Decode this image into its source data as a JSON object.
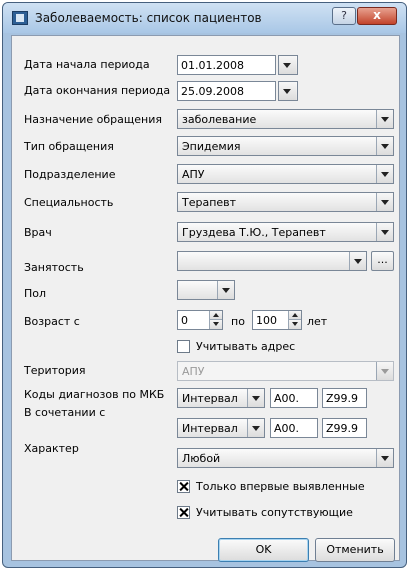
{
  "window": {
    "title": "Заболеваемость: список пациентов",
    "help_label": "?",
    "close_label": "x"
  },
  "form": {
    "period_start": {
      "label": "Дата начала периода",
      "value": "01.01.2008"
    },
    "period_end": {
      "label": "Дата окончания периода",
      "value": "25.09.2008"
    },
    "purpose": {
      "label": "Назначение обращения",
      "value": "заболевание"
    },
    "visit_type": {
      "label": "Тип обращения",
      "value": "Эпидемия"
    },
    "department": {
      "label": "Подразделение",
      "value": "АПУ"
    },
    "specialty": {
      "label": "Специальность",
      "value": "Терапевт"
    },
    "doctor": {
      "label": "Врач",
      "value": "Груздева Т.Ю., Терапевт"
    },
    "employment": {
      "label": "Занятость",
      "value": "",
      "ellipsis": "..."
    },
    "sex": {
      "label": "Пол",
      "value": ""
    },
    "age": {
      "label": "Возраст с",
      "from": "0",
      "to_label": "по",
      "to": "100",
      "unit": "лет"
    },
    "use_address": {
      "label": "Учитывать адрес",
      "checked": false
    },
    "territory": {
      "label": "Територия",
      "value": "АПУ"
    },
    "icd_codes": {
      "label": "Коды диагнозов по МКБ",
      "mode": "Интервал",
      "from": "A00.",
      "to": "Z99.9"
    },
    "combined": {
      "label": "В сочетании с",
      "mode": "Интервал",
      "from": "A00.",
      "to": "Z99.9"
    },
    "character": {
      "label": "Характер",
      "value": "Любой"
    },
    "first_time_only": {
      "label": "Только впервые выявленные",
      "checked": true
    },
    "consider_comorbid": {
      "label": "Учитывать сопутствующие",
      "checked": true
    }
  },
  "buttons": {
    "ok": "OK",
    "cancel": "Отменить"
  }
}
